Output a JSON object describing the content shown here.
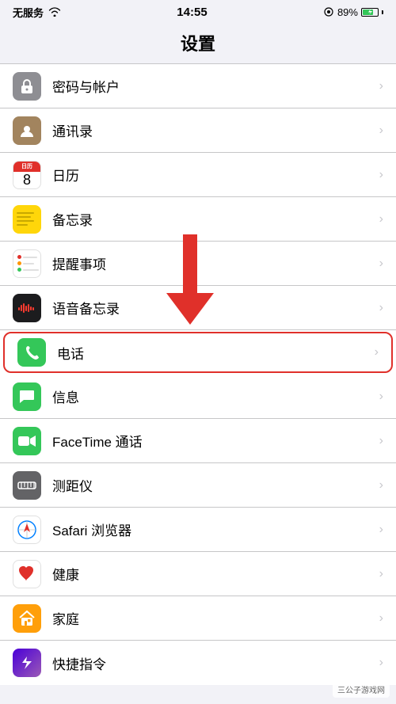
{
  "statusBar": {
    "carrier": "无服务",
    "time": "14:55",
    "battery": "89%"
  },
  "header": {
    "title": "设置"
  },
  "items": [
    {
      "id": "passwords",
      "label": "密码与帐户",
      "iconType": "passwords",
      "highlighted": false
    },
    {
      "id": "contacts",
      "label": "通讯录",
      "iconType": "contacts",
      "highlighted": false
    },
    {
      "id": "calendar",
      "label": "日历",
      "iconType": "calendar",
      "highlighted": false
    },
    {
      "id": "notes",
      "label": "备忘录",
      "iconType": "notes",
      "highlighted": false
    },
    {
      "id": "reminders",
      "label": "提醒事项",
      "iconType": "reminders",
      "highlighted": false
    },
    {
      "id": "voice-memos",
      "label": "语音备忘录",
      "iconType": "voicememo",
      "highlighted": false
    },
    {
      "id": "phone",
      "label": "电话",
      "iconType": "phone",
      "highlighted": true
    },
    {
      "id": "messages",
      "label": "信息",
      "iconType": "messages",
      "highlighted": false
    },
    {
      "id": "facetime",
      "label": "FaceTime 通话",
      "iconType": "facetime",
      "highlighted": false
    },
    {
      "id": "measure",
      "label": "测距仪",
      "iconType": "measure",
      "highlighted": false
    },
    {
      "id": "safari",
      "label": "Safari 浏览器",
      "iconType": "safari",
      "highlighted": false
    },
    {
      "id": "health",
      "label": "健康",
      "iconType": "health",
      "highlighted": false
    },
    {
      "id": "home",
      "label": "家庭",
      "iconType": "home",
      "highlighted": false
    },
    {
      "id": "shortcuts",
      "label": "快捷指令",
      "iconType": "shortcuts",
      "highlighted": false
    }
  ],
  "watermark": "三公子游戏网"
}
